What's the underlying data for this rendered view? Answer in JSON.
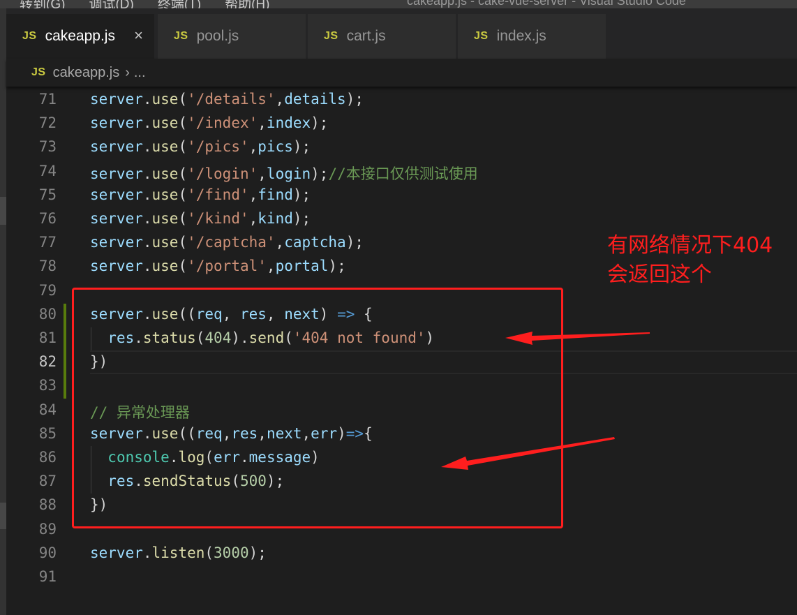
{
  "window": {
    "menu": [
      "转到(G)",
      "调试(D)",
      "终端(T)",
      "帮助(H)"
    ],
    "title": "cakeapp.js - cake-vue-server - Visual Studio Code"
  },
  "tabs": [
    {
      "icon": "JS",
      "label": "cakeapp.js",
      "active": true,
      "close": "×"
    },
    {
      "icon": "JS",
      "label": "pool.js",
      "active": false
    },
    {
      "icon": "JS",
      "label": "cart.js",
      "active": false
    },
    {
      "icon": "JS",
      "label": "index.js",
      "active": false
    }
  ],
  "breadcrumb": {
    "icon": "JS",
    "file": "cakeapp.js",
    "separator": "›",
    "rest": "..."
  },
  "editor": {
    "current_line": 82,
    "lines": [
      {
        "n": "71",
        "text": "server.use('/details',details);"
      },
      {
        "n": "72",
        "text": "server.use('/index',index);"
      },
      {
        "n": "73",
        "text": "server.use('/pics',pics);"
      },
      {
        "n": "74",
        "text": "server.use('/login',login);//本接口仅供测试使用"
      },
      {
        "n": "75",
        "text": "server.use('/find',find);"
      },
      {
        "n": "76",
        "text": "server.use('/kind',kind);"
      },
      {
        "n": "77",
        "text": "server.use('/captcha',captcha);"
      },
      {
        "n": "78",
        "text": "server.use('/portal',portal);"
      },
      {
        "n": "79",
        "text": ""
      },
      {
        "n": "80",
        "text": "server.use((req, res, next) => {"
      },
      {
        "n": "81",
        "text": "  res.status(404).send('404 not found')"
      },
      {
        "n": "82",
        "text": "})"
      },
      {
        "n": "83",
        "text": ""
      },
      {
        "n": "84",
        "text": "// 异常处理器"
      },
      {
        "n": "85",
        "text": "server.use((req,res,next,err)=>{"
      },
      {
        "n": "86",
        "text": "  console.log(err.message)"
      },
      {
        "n": "87",
        "text": "  res.sendStatus(500);"
      },
      {
        "n": "88",
        "text": "})"
      },
      {
        "n": "89",
        "text": ""
      },
      {
        "n": "90",
        "text": "server.listen(3000);"
      },
      {
        "n": "91",
        "text": ""
      }
    ]
  },
  "annotation": {
    "text": "有网络情况下404\n会返回这个",
    "color": "#ff1e1e"
  },
  "colors": {
    "background": "#1e1e1e",
    "identifier": "#9cdcfe",
    "function": "#dcdcaa",
    "string": "#ce9178",
    "number": "#b5cea8",
    "comment": "#6a9955",
    "keyword": "#569cd6",
    "js_icon": "#cbcb41",
    "git_modified": "#587c0c"
  }
}
